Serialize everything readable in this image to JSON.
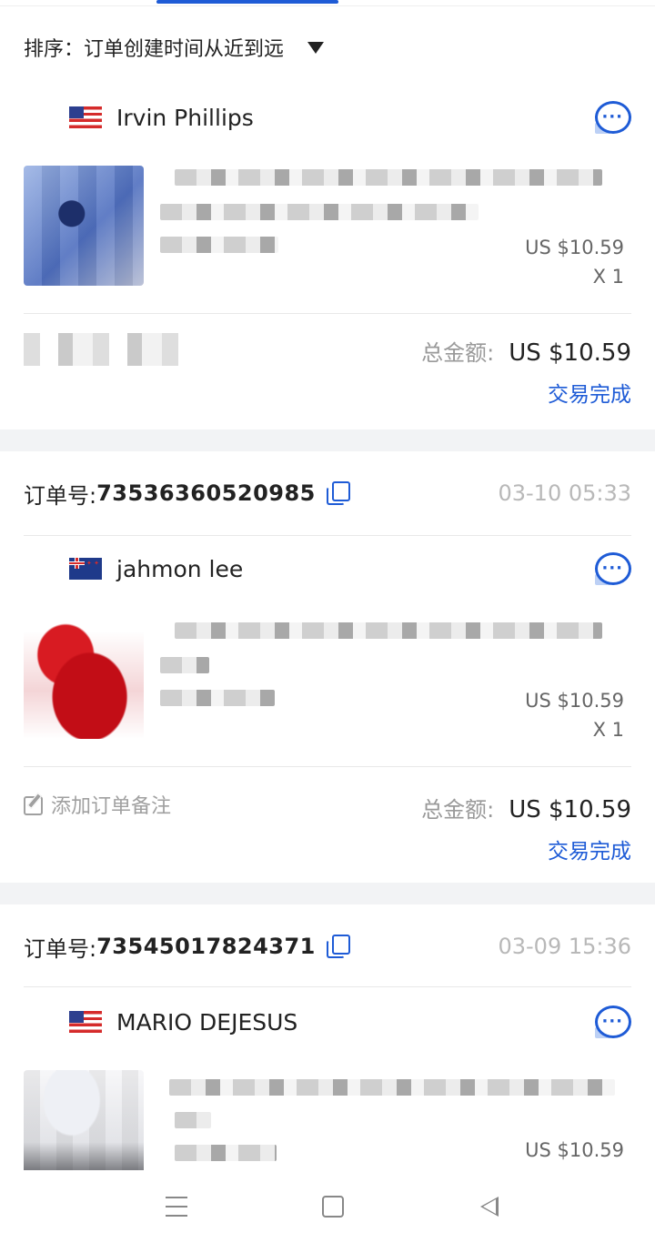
{
  "sort": {
    "label": "排序：订单创建时间从近到远"
  },
  "orders": [
    {
      "buyer": "Irvin Phillips",
      "flag": "us-flag",
      "price": "US $10.59",
      "qty": "X 1",
      "total_label": "总金额:",
      "total": "US $10.59",
      "status": "交易完成"
    },
    {
      "number_label": "订单号:",
      "number": "73536360520985",
      "time": "03-10 05:33",
      "buyer": "jahmon lee",
      "flag": "nz-flag",
      "price": "US $10.59",
      "qty": "X 1",
      "note": "添加订单备注",
      "total_label": "总金额:",
      "total": "US $10.59",
      "status": "交易完成"
    },
    {
      "number_label": "订单号:",
      "number": "73545017824371",
      "time": "03-09 15:36",
      "buyer": "MARIO DEJESUS",
      "flag": "us-flag",
      "price": "US $10.59"
    }
  ],
  "colors": {
    "accent": "#1e5bd6",
    "muted": "#b8b8b8",
    "separator": "#f2f3f5"
  },
  "icons": [
    "copy-icon",
    "chat-icon",
    "note-edit-icon",
    "menu-icon",
    "home-icon",
    "back-icon"
  ]
}
